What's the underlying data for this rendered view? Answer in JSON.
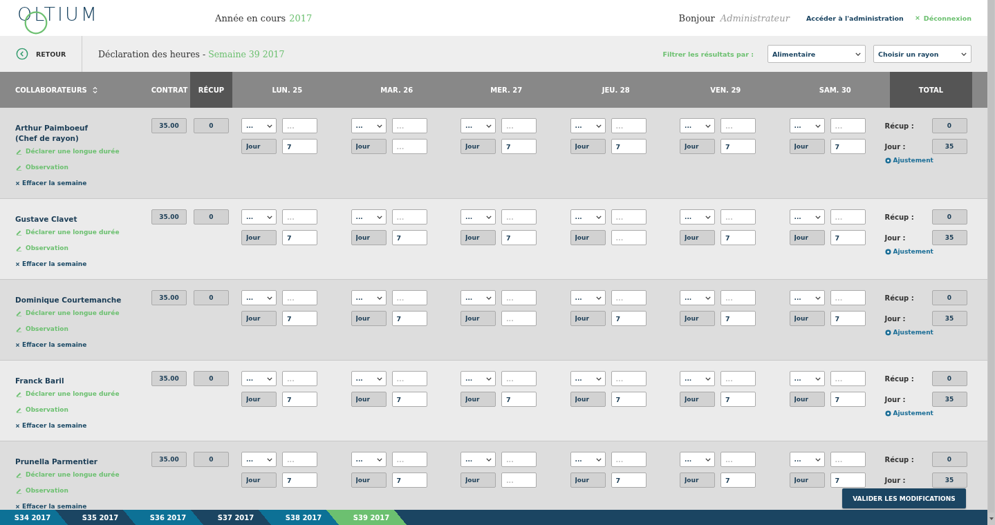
{
  "header": {
    "logo": "OLTIUM",
    "year_label": "Année en cours",
    "year": "2017",
    "greeting": "Bonjour",
    "user": "Administrateur",
    "admin_link": "Accéder à l'administration",
    "logout": "Déconnexion"
  },
  "toolbar": {
    "back": "RETOUR",
    "title": "Déclaration des heures -",
    "week": "Semaine 39 2017",
    "filter_label": "Filtrer les résultats par :",
    "filters": [
      {
        "value": "Alimentaire"
      },
      {
        "value": "Choisir un rayon"
      }
    ]
  },
  "columns": [
    {
      "label": "COLLABORATEURS",
      "kind": "name",
      "sortable": true,
      "highlighted": false
    },
    {
      "label": "CONTRAT",
      "kind": "contract",
      "sortable": false,
      "highlighted": false
    },
    {
      "label": "RÉCUP",
      "kind": "recup",
      "sortable": false,
      "highlighted": true
    },
    {
      "label": "LUN. 25",
      "kind": "day",
      "sortable": false,
      "highlighted": false
    },
    {
      "label": "MAR. 26",
      "kind": "day",
      "sortable": false,
      "highlighted": false
    },
    {
      "label": "MER. 27",
      "kind": "day",
      "sortable": false,
      "highlighted": false
    },
    {
      "label": "JEU. 28",
      "kind": "day",
      "sortable": false,
      "highlighted": false
    },
    {
      "label": "VEN. 29",
      "kind": "day",
      "sortable": false,
      "highlighted": false
    },
    {
      "label": "SAM. 30",
      "kind": "day",
      "sortable": false,
      "highlighted": false
    },
    {
      "label": "TOTAL",
      "kind": "total",
      "sortable": false,
      "highlighted": true
    }
  ],
  "rows": [
    {
      "name": "Arthur Paimboeuf",
      "role": "(Chef de rayon)",
      "contract": "35.00",
      "recup": "0",
      "actions": [
        {
          "kind": "long",
          "label": "Déclarer une longue durée"
        },
        {
          "kind": "note",
          "label": "Observation"
        },
        {
          "kind": "clear",
          "label": "Effacer la semaine"
        }
      ],
      "days": [
        {
          "option": "...",
          "hours_placeholder": "...",
          "type": "Jour",
          "value": "7"
        },
        {
          "option": "...",
          "hours_placeholder": "...",
          "type": "Jour",
          "placeholder": "..."
        },
        {
          "option": "...",
          "hours_placeholder": "...",
          "type": "Jour",
          "value": "7"
        },
        {
          "option": "...",
          "hours_placeholder": "...",
          "type": "Jour",
          "value": "7"
        },
        {
          "option": "...",
          "hours_placeholder": "...",
          "type": "Jour",
          "value": "7"
        },
        {
          "option": "...",
          "hours_placeholder": "...",
          "type": "Jour",
          "value": "7"
        }
      ],
      "totals": {
        "recup_label": "Récup :",
        "recup": "0",
        "day_label": "Jour :",
        "day": "35",
        "adjustment": "Ajustement"
      }
    },
    {
      "name": "Gustave Clavet",
      "contract": "35.00",
      "recup": "0",
      "actions": [
        {
          "kind": "long",
          "label": "Déclarer une longue durée"
        },
        {
          "kind": "note",
          "label": "Observation"
        },
        {
          "kind": "clear",
          "label": "Effacer la semaine"
        }
      ],
      "days": [
        {
          "option": "...",
          "hours_placeholder": "...",
          "type": "Jour",
          "value": "7"
        },
        {
          "option": "...",
          "hours_placeholder": "...",
          "type": "Jour",
          "value": "7"
        },
        {
          "option": "...",
          "hours_placeholder": "...",
          "type": "Jour",
          "value": "7"
        },
        {
          "option": "...",
          "hours_placeholder": "...",
          "type": "Jour",
          "placeholder": "..."
        },
        {
          "option": "...",
          "hours_placeholder": "...",
          "type": "Jour",
          "value": "7"
        },
        {
          "option": "...",
          "hours_placeholder": "...",
          "type": "Jour",
          "value": "7"
        }
      ],
      "totals": {
        "recup_label": "Récup :",
        "recup": "0",
        "day_label": "Jour :",
        "day": "35",
        "adjustment": "Ajustement"
      }
    },
    {
      "name": "Dominique Courtemanche",
      "contract": "35.00",
      "recup": "0",
      "actions": [
        {
          "kind": "long",
          "label": "Déclarer une longue durée"
        },
        {
          "kind": "note",
          "label": "Observation"
        },
        {
          "kind": "clear",
          "label": "Effacer la semaine"
        }
      ],
      "days": [
        {
          "option": "...",
          "hours_placeholder": "...",
          "type": "Jour",
          "value": "7"
        },
        {
          "option": "...",
          "hours_placeholder": "...",
          "type": "Jour",
          "value": "7"
        },
        {
          "option": "...",
          "hours_placeholder": "...",
          "type": "Jour",
          "placeholder": "..."
        },
        {
          "option": "...",
          "hours_placeholder": "...",
          "type": "Jour",
          "value": "7"
        },
        {
          "option": "...",
          "hours_placeholder": "...",
          "type": "Jour",
          "value": "7"
        },
        {
          "option": "...",
          "hours_placeholder": "...",
          "type": "Jour",
          "value": "7"
        }
      ],
      "totals": {
        "recup_label": "Récup :",
        "recup": "0",
        "day_label": "Jour :",
        "day": "35",
        "adjustment": "Ajustement"
      }
    },
    {
      "name": "Franck Baril",
      "contract": "35.00",
      "recup": "0",
      "actions": [
        {
          "kind": "long",
          "label": "Déclarer une longue durée"
        },
        {
          "kind": "note",
          "label": "Observation"
        },
        {
          "kind": "clear",
          "label": "Effacer la semaine"
        }
      ],
      "days": [
        {
          "option": "...",
          "hours_placeholder": "...",
          "type": "Jour",
          "value": "7"
        },
        {
          "option": "...",
          "hours_placeholder": "...",
          "type": "Jour",
          "value": "7"
        },
        {
          "option": "...",
          "hours_placeholder": "...",
          "type": "Jour",
          "value": "7"
        },
        {
          "option": "...",
          "hours_placeholder": "...",
          "type": "Jour",
          "value": "7"
        },
        {
          "option": "...",
          "hours_placeholder": "...",
          "type": "Jour",
          "value": "7"
        },
        {
          "option": "...",
          "hours_placeholder": "...",
          "type": "Jour",
          "value": "7"
        }
      ],
      "totals": {
        "recup_label": "Récup :",
        "recup": "0",
        "day_label": "Jour :",
        "day": "35",
        "adjustment": "Ajustement"
      }
    },
    {
      "name": "Prunella Parmentier",
      "contract": "35.00",
      "recup": "0",
      "actions": [
        {
          "kind": "long",
          "label": "Déclarer une longue durée"
        },
        {
          "kind": "note",
          "label": "Observation"
        },
        {
          "kind": "clear",
          "label": "Effacer la semaine"
        }
      ],
      "days": [
        {
          "option": "...",
          "hours_placeholder": "...",
          "type": "Jour",
          "value": "7"
        },
        {
          "option": "...",
          "hours_placeholder": "...",
          "type": "Jour",
          "value": "7"
        },
        {
          "option": "...",
          "hours_placeholder": "...",
          "type": "Jour",
          "placeholder": "..."
        },
        {
          "option": "...",
          "hours_placeholder": "...",
          "type": "Jour",
          "value": "7"
        },
        {
          "option": "...",
          "hours_placeholder": "...",
          "type": "Jour",
          "value": "7"
        },
        {
          "option": "...",
          "hours_placeholder": "...",
          "type": "Jour",
          "value": "7"
        }
      ],
      "totals": {
        "recup_label": "Récup :",
        "recup": "0",
        "day_label": "Jour :",
        "day": "35"
      }
    }
  ],
  "submit_button": "VALIDER LES MODIFICATIONS",
  "weeks": [
    {
      "label": "S34 2017",
      "selected": false
    },
    {
      "label": "S35 2017",
      "selected": false
    },
    {
      "label": "S36 2017",
      "selected": false
    },
    {
      "label": "S37 2017",
      "selected": false
    },
    {
      "label": "S38 2017",
      "selected": false
    },
    {
      "label": "S39 2017",
      "selected": true
    }
  ]
}
